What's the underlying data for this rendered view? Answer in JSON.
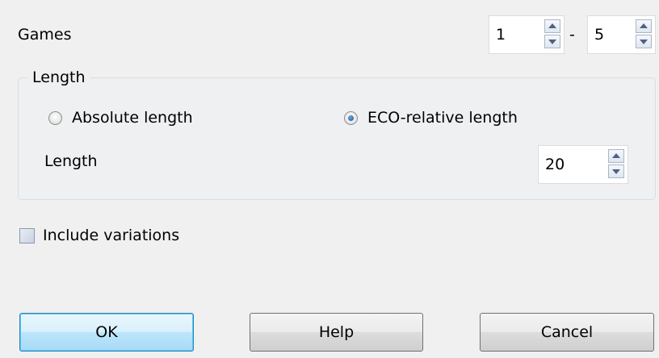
{
  "games": {
    "label": "Games",
    "from_value": "1",
    "separator": "-",
    "to_value": "5"
  },
  "length_group": {
    "title": "Length",
    "absolute_label": "Absolute length",
    "absolute_selected": false,
    "eco_label": "ECO-relative length",
    "eco_selected": true,
    "length_label": "Length",
    "length_value": "20"
  },
  "include_variations": {
    "label": "Include variations",
    "checked": false
  },
  "buttons": {
    "ok": "OK",
    "help": "Help",
    "cancel": "Cancel"
  }
}
